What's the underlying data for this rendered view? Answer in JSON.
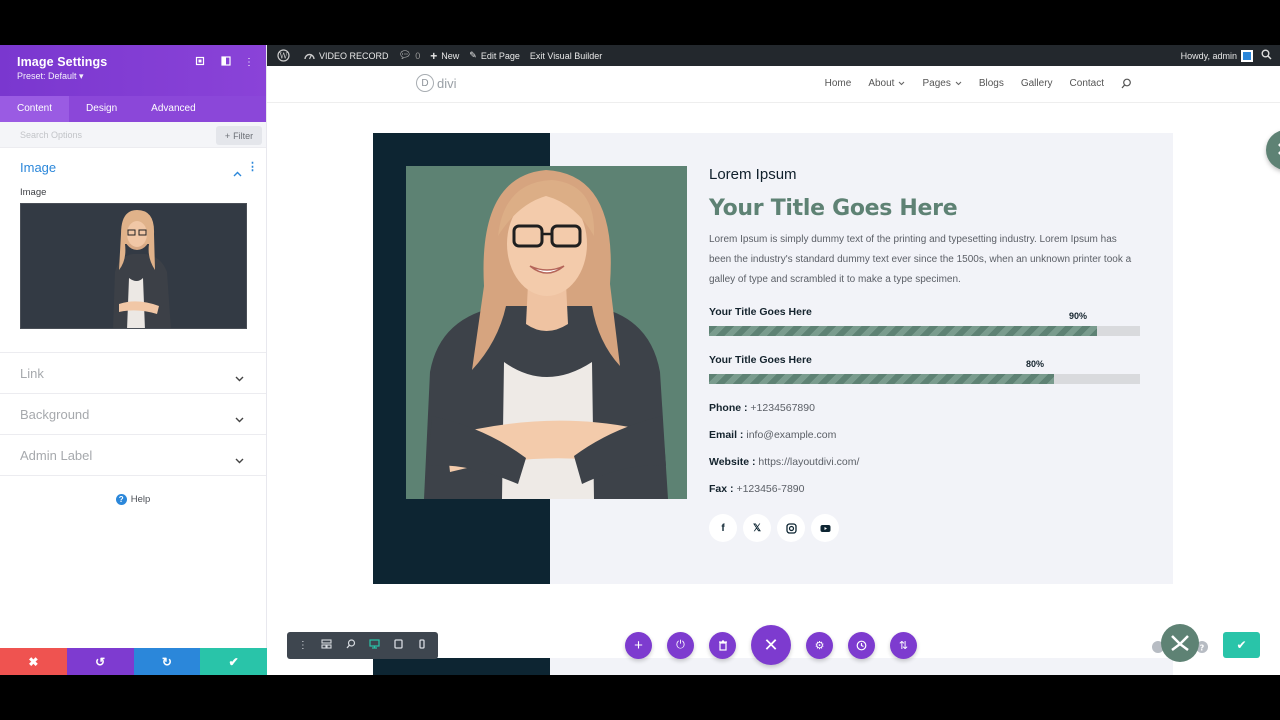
{
  "panel": {
    "title": "Image Settings",
    "preset": "Preset: Default",
    "preset_caret": "▾",
    "tabs": [
      "Content",
      "Design",
      "Advanced"
    ],
    "search_placeholder": "Search Options",
    "filter_label": "Filter",
    "sections": {
      "image": {
        "title": "Image",
        "field_label": "Image"
      },
      "link": "Link",
      "background": "Background",
      "admin_label": "Admin Label"
    },
    "help": "Help"
  },
  "adminbar": {
    "site_name": "VIDEO RECORD",
    "comments": "0",
    "new": "New",
    "edit_page": "Edit Page",
    "exit_vb": "Exit Visual Builder",
    "howdy": "Howdy, admin"
  },
  "site": {
    "logo": "divi",
    "logo_mark": "D",
    "nav": [
      {
        "label": "Home",
        "dropdown": false
      },
      {
        "label": "About",
        "dropdown": true
      },
      {
        "label": "Pages",
        "dropdown": true
      },
      {
        "label": "Blogs",
        "dropdown": false
      },
      {
        "label": "Gallery",
        "dropdown": false
      },
      {
        "label": "Contact",
        "dropdown": false
      }
    ]
  },
  "content": {
    "overline": "Lorem Ipsum",
    "title": "Your Title Goes Here",
    "description": "Lorem Ipsum is simply dummy text of the printing and typesetting industry. Lorem Ipsum has been the industry's standard dummy text ever since the 1500s, when an unknown printer took a galley of type and scrambled it to make a type specimen.",
    "skills": [
      {
        "name": "Your Title Goes Here",
        "percent_label": "90%",
        "value": 0.9
      },
      {
        "name": "Your Title Goes Here",
        "percent_label": "80%",
        "value": 0.8
      }
    ],
    "contacts": [
      {
        "label": "Phone :",
        "value": "+1234567890"
      },
      {
        "label": "Email :",
        "value": "info@example.com"
      },
      {
        "label": "Website :",
        "value": "https://layoutdivi.com/"
      },
      {
        "label": "Fax :",
        "value": "+123456-7890"
      }
    ],
    "socials": [
      "facebook-icon",
      "x-twitter-icon",
      "instagram-icon",
      "youtube-icon"
    ]
  },
  "colors": {
    "purple": "#7e3bd0",
    "sage": "#5e8274",
    "navy": "#0d2532",
    "teal": "#29c4a9",
    "red": "#ef5350",
    "blue": "#2b87da"
  }
}
